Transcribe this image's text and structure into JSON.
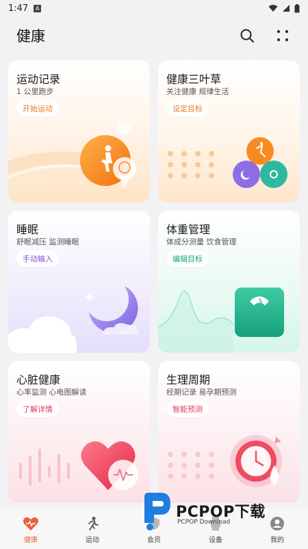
{
  "status": {
    "time": "1:47",
    "badge": "A"
  },
  "header": {
    "title": "健康"
  },
  "cards": {
    "exercise": {
      "title": "运动记录",
      "subtitle": "1 公里跑步",
      "action": "开始运动",
      "action_color": "#e8782e"
    },
    "clover": {
      "title": "健康三叶草",
      "subtitle": "关注健康 规律生活",
      "action": "设定目标",
      "action_color": "#e8782e"
    },
    "sleep": {
      "title": "睡眠",
      "subtitle": "舒眠减压 监测睡眠",
      "action": "手动输入",
      "action_color": "#8a4fd6"
    },
    "weight": {
      "title": "体重管理",
      "subtitle": "体成分测量 饮食管理",
      "action": "编辑目标",
      "action_color": "#1aa37f"
    },
    "heart": {
      "title": "心脏健康",
      "subtitle": "心率监测 心电图解读",
      "action": "了解详情",
      "action_color": "#e0395b"
    },
    "cycle": {
      "title": "生理周期",
      "subtitle": "经期记录 易孕期预测",
      "action": "智能预测",
      "action_color": "#e0395b"
    }
  },
  "nav": {
    "items": [
      {
        "label": "健康",
        "icon": "heart-pulse-icon"
      },
      {
        "label": "运动",
        "icon": "running-icon"
      },
      {
        "label": "会员",
        "icon": "member-icon"
      },
      {
        "label": "设备",
        "icon": "watch-icon"
      },
      {
        "label": "我的",
        "icon": "profile-icon"
      }
    ],
    "active_color": "#e8613a"
  },
  "watermark": {
    "text": "PCPOP下载",
    "sub": "PCPOP Download"
  }
}
